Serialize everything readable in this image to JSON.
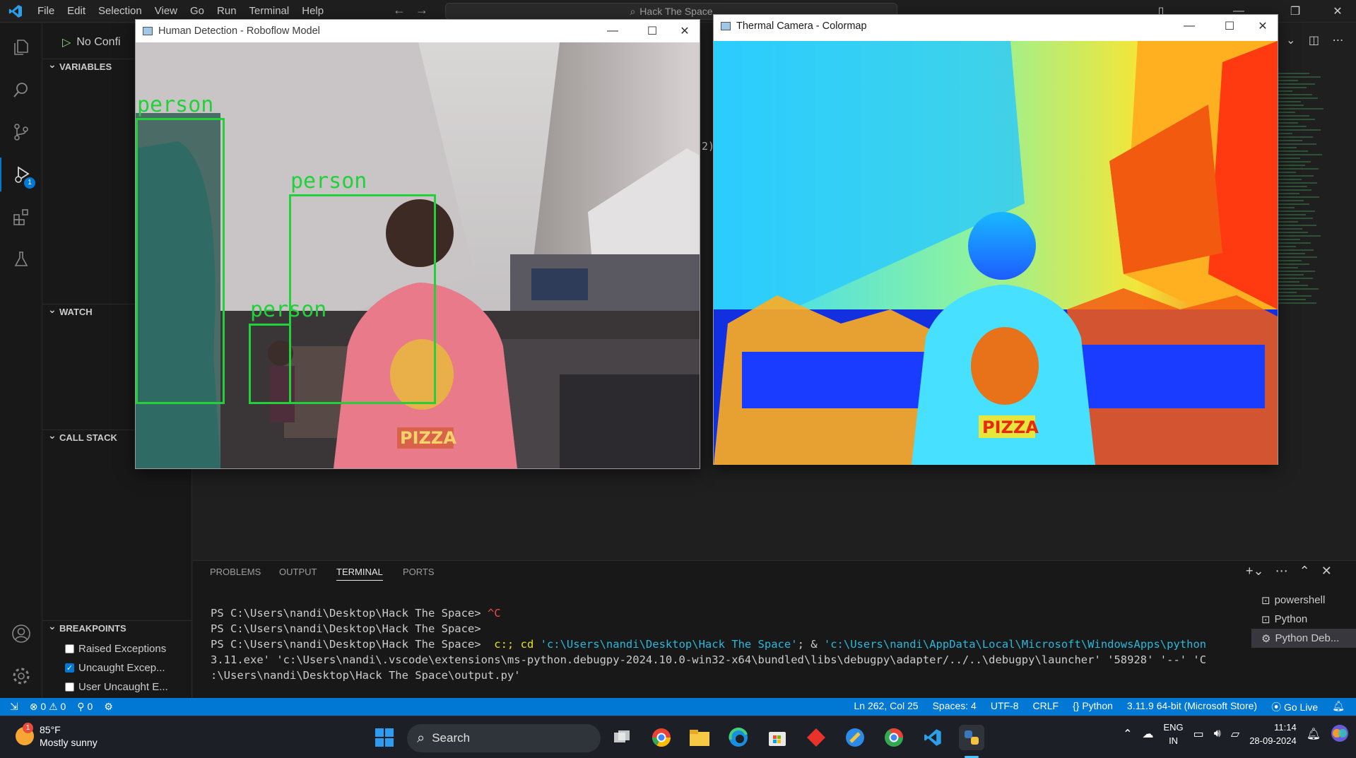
{
  "titlebar": {
    "menu": [
      "File",
      "Edit",
      "Selection",
      "View",
      "Go",
      "Run",
      "Terminal",
      "Help"
    ],
    "search_text": "Hack The Space"
  },
  "debug": {
    "config_label": "No Confi",
    "sections": {
      "variables": "VARIABLES",
      "watch": "WATCH",
      "call_stack": "CALL STACK",
      "breakpoints": "BREAKPOINTS"
    },
    "breakpoints": [
      {
        "label": "Raised Exceptions",
        "checked": false
      },
      {
        "label": "Uncaught Excep...",
        "checked": true
      },
      {
        "label": "User Uncaught E...",
        "checked": false
      }
    ],
    "run_badge": "1"
  },
  "windows": {
    "detection": {
      "title": "Human Detection - Roboflow Model",
      "labels": [
        "person",
        "person",
        "person"
      ]
    },
    "thermal": {
      "title": "Thermal Camera - Colormap"
    }
  },
  "panel": {
    "tabs": [
      "PROBLEMS",
      "OUTPUT",
      "TERMINAL",
      "PORTS"
    ],
    "active_tab": "TERMINAL",
    "terminal": {
      "line1_prompt": "PS C:\\Users\\nandi\\Desktop\\Hack The Space>",
      "line1_ctrl": " ^C",
      "line2_prompt": "PS C:\\Users\\nandi\\Desktop\\Hack The Space>",
      "line3_prompt": "PS C:\\Users\\nandi\\Desktop\\Hack The Space>",
      "line3_cmd_a": "  c:; ",
      "line3_cmd_b": "cd ",
      "line3_str1": "'c:\\Users\\nandi\\Desktop\\Hack The Space'",
      "line3_cmd_c": "; & ",
      "line3_str2": "'c:\\Users\\nandi\\AppData\\Local\\Microsoft\\WindowsApps\\python",
      "line4": "3.11.exe' 'c:\\Users\\nandi\\.vscode\\extensions\\ms-python.debugpy-2024.10.0-win32-x64\\bundled\\libs\\debugpy\\adapter/../..\\debugpy\\launcher' '58928' '--' 'C",
      "line5": ":\\Users\\nandi\\Desktop\\Hack The Space\\output.py'"
    },
    "terminal_list": [
      "powershell",
      "Python",
      "Python Deb..."
    ]
  },
  "statusbar": {
    "errors": "0",
    "warnings": "0",
    "ports": "0",
    "position": "Ln 262, Col 25",
    "spaces": "Spaces: 4",
    "encoding": "UTF-8",
    "eol": "CRLF",
    "language": "Python",
    "interpreter": "3.11.9 64-bit (Microsoft Store)",
    "golive": "Go Live"
  },
  "taskbar": {
    "weather_temp": "85°F",
    "weather_desc": "Mostly sunny",
    "weather_badge": "1",
    "search_label": "Search",
    "lang_top": "ENG",
    "lang_bottom": "IN",
    "time": "11:14",
    "date": "28-09-2024"
  },
  "colors": {
    "accent": "#0078d4",
    "detection_box": "#22d13a"
  }
}
